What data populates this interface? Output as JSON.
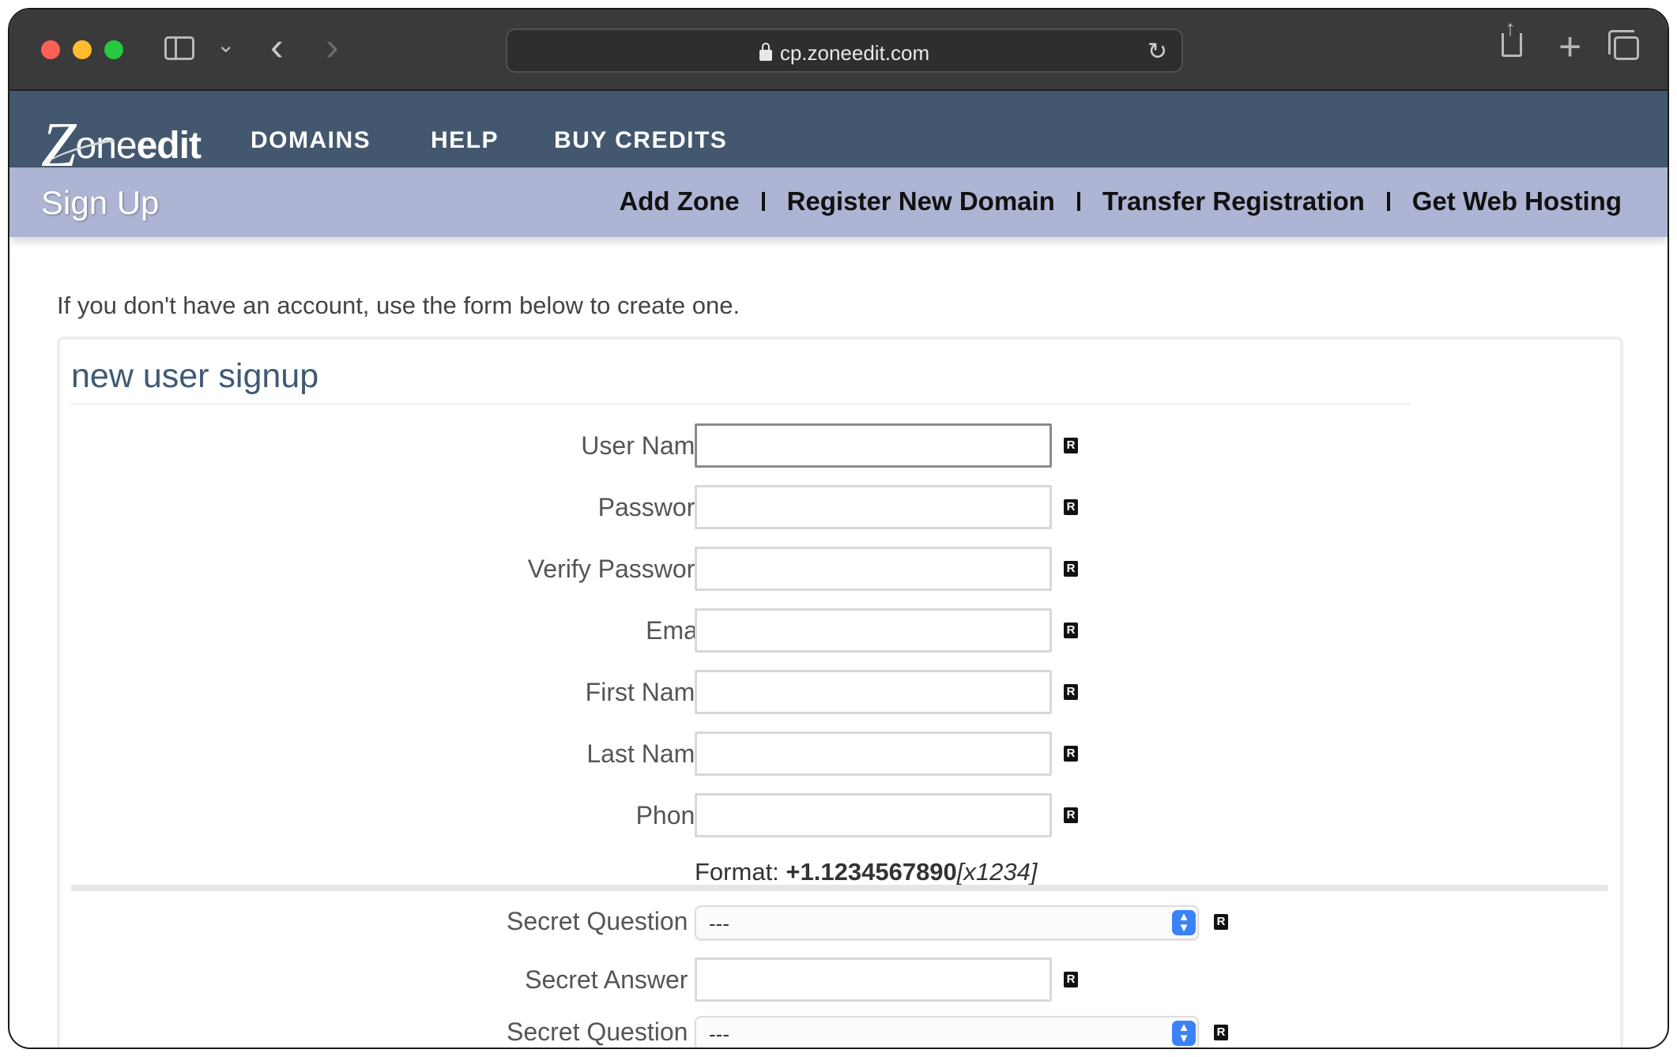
{
  "browser": {
    "url": "cp.zoneedit.com"
  },
  "site": {
    "logo_z": "Z",
    "logo_one": "one",
    "logo_edit": "edit",
    "nav": {
      "domains": "DOMAINS",
      "help": "HELP",
      "buy_credits": "BUY CREDITS"
    },
    "subnav": {
      "title": "Sign Up",
      "links": [
        "Add Zone",
        "Register New Domain",
        "Transfer Registration",
        "Get Web Hosting"
      ]
    }
  },
  "page": {
    "intro": "If you don't have an account, use the form below to create one.",
    "form_title": "new user signup",
    "required_glyph": "R",
    "fields": {
      "username": {
        "label": "User Name:",
        "value": ""
      },
      "password": {
        "label": "Password:",
        "value": ""
      },
      "verify_password": {
        "label": "Verify Password:",
        "value": ""
      },
      "email": {
        "label": "Email:",
        "value": ""
      },
      "first_name": {
        "label": "First Name:",
        "value": ""
      },
      "last_name": {
        "label": "Last Name:",
        "value": ""
      },
      "phone": {
        "label": "Phone:",
        "value": ""
      },
      "secret_question_1": {
        "label": "Secret Question 1:",
        "value": "---"
      },
      "secret_answer_1": {
        "label": "Secret Answer 1:",
        "value": ""
      },
      "secret_question_2": {
        "label": "Secret Question 2:",
        "value": "---"
      }
    },
    "phone_format": {
      "prefix": "Format:",
      "example": "+1.1234567890",
      "extension": "[x1234]"
    }
  },
  "colors": {
    "nav_bg": "#43586f",
    "subnav_bg": "#aeb4d3",
    "title_color": "#3f5a73",
    "select_accent": "#3b82f6"
  }
}
